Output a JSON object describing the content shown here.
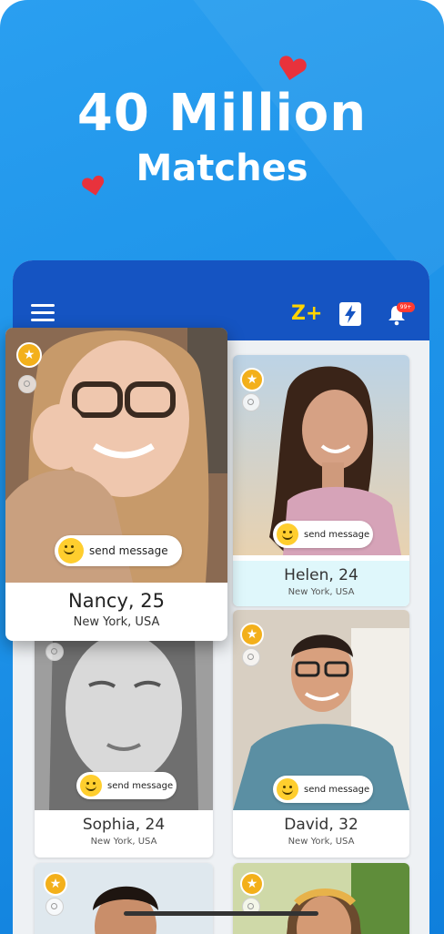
{
  "promo": {
    "headline_line1": "40 Million",
    "headline_line2": "Matches"
  },
  "colors": {
    "background": "#1f95ea",
    "topbar": "#1554c2",
    "zplus": "#ffd400",
    "heart": "#e8323c",
    "star": "#f3b01b",
    "notification_badge": "#ff3b30"
  },
  "topbar": {
    "menu_icon": "hamburger-menu-icon",
    "zplus_label": "Z+",
    "boost_icon": "lightning-bolt-icon",
    "bell_icon": "bell-icon",
    "bell_badge": "99+"
  },
  "profiles": [
    {
      "name": "Nancy, 25",
      "location": "New York, USA",
      "action": "send message",
      "featured": true
    },
    {
      "name": "Helen, 24",
      "location": "New York, USA",
      "action": "send message"
    },
    {
      "name": "Sophia, 24",
      "location": "New York, USA",
      "action": "send message"
    },
    {
      "name": "David, 32",
      "location": "New York, USA",
      "action": "send message"
    },
    {
      "name": "",
      "location": "",
      "action": ""
    },
    {
      "name": "",
      "location": "",
      "action": ""
    }
  ]
}
